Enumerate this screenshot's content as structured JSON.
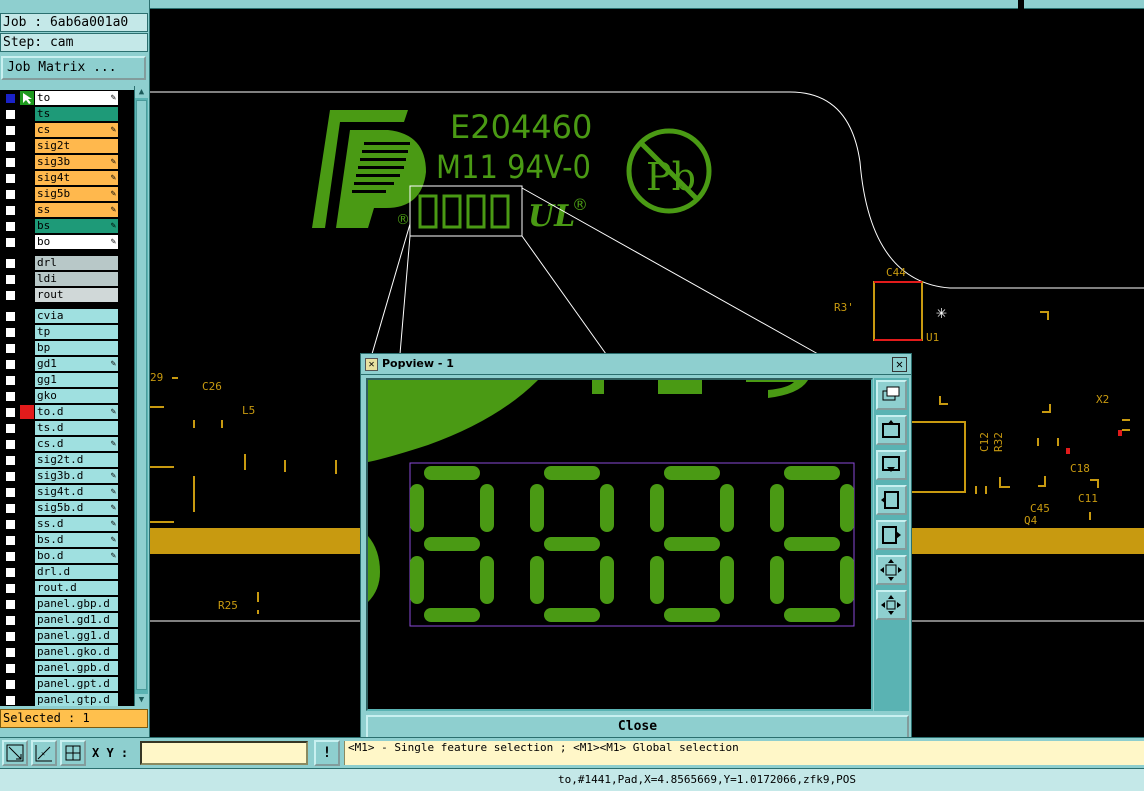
{
  "colors": {
    "panel_bg": "#8ecfcf",
    "canvas_bg": "#000000",
    "copper_green": "#4a9a14",
    "layer_orange": "#ffb84d",
    "layer_teal": "#1e9a78",
    "layer_light_cyan": "#9fe0e0",
    "layer_gray": "#b8c8c8",
    "marker_red": "#e21b1b",
    "trace_gold": "#c89a10",
    "silk_white": "#ffffff",
    "highlight_purple": "#8a4ad8"
  },
  "left_panel": {
    "job_label": "Job : 6ab6a001a0",
    "step_label": "Step: cam",
    "job_matrix_button": "Job Matrix ...",
    "selected_label": "Selected : 1",
    "layers": [
      {
        "name": "to",
        "color": "#ffffff",
        "checked": true,
        "marker": "cursor",
        "editable": true,
        "group": 1
      },
      {
        "name": "ts",
        "color": "#1e9a78",
        "checked": false,
        "editable": false,
        "group": 1
      },
      {
        "name": "cs",
        "color": "#ffb84d",
        "checked": false,
        "editable": true,
        "group": 1
      },
      {
        "name": "sig2t",
        "color": "#ffb84d",
        "checked": false,
        "editable": false,
        "group": 1
      },
      {
        "name": "sig3b",
        "color": "#ffb84d",
        "checked": false,
        "editable": true,
        "group": 1
      },
      {
        "name": "sig4t",
        "color": "#ffb84d",
        "checked": false,
        "editable": true,
        "group": 1
      },
      {
        "name": "sig5b",
        "color": "#ffb84d",
        "checked": false,
        "editable": true,
        "group": 1
      },
      {
        "name": "ss",
        "color": "#ffb84d",
        "checked": false,
        "editable": true,
        "group": 1
      },
      {
        "name": "bs",
        "color": "#1e9a78",
        "checked": false,
        "editable": true,
        "group": 1
      },
      {
        "name": "bo",
        "color": "#ffffff",
        "checked": false,
        "editable": true,
        "group": 1
      },
      {
        "name": "drl",
        "color": "#b8c8c8",
        "checked": false,
        "editable": false,
        "group": 2
      },
      {
        "name": "ldi",
        "color": "#b8c8c8",
        "checked": false,
        "editable": false,
        "group": 2
      },
      {
        "name": "rout",
        "color": "#d0d8d8",
        "checked": false,
        "editable": false,
        "group": 2
      },
      {
        "name": "cvia",
        "color": "#9fe0e0",
        "checked": false,
        "editable": false,
        "group": 3
      },
      {
        "name": "tp",
        "color": "#9fe0e0",
        "checked": false,
        "editable": false,
        "group": 3
      },
      {
        "name": "bp",
        "color": "#9fe0e0",
        "checked": false,
        "editable": false,
        "group": 3
      },
      {
        "name": "gd1",
        "color": "#9fe0e0",
        "checked": false,
        "editable": true,
        "group": 3
      },
      {
        "name": "gg1",
        "color": "#9fe0e0",
        "checked": false,
        "editable": false,
        "group": 3
      },
      {
        "name": "gko",
        "color": "#9fe0e0",
        "checked": false,
        "editable": false,
        "group": 3
      },
      {
        "name": "to.d",
        "color": "#9fe0e0",
        "checked": false,
        "marker": "red",
        "editable": true,
        "group": 3
      },
      {
        "name": "ts.d",
        "color": "#9fe0e0",
        "checked": false,
        "editable": false,
        "group": 3
      },
      {
        "name": "cs.d",
        "color": "#9fe0e0",
        "checked": false,
        "editable": true,
        "group": 3
      },
      {
        "name": "sig2t.d",
        "color": "#9fe0e0",
        "checked": false,
        "editable": false,
        "group": 3
      },
      {
        "name": "sig3b.d",
        "color": "#9fe0e0",
        "checked": false,
        "editable": true,
        "group": 3
      },
      {
        "name": "sig4t.d",
        "color": "#9fe0e0",
        "checked": false,
        "editable": true,
        "group": 3
      },
      {
        "name": "sig5b.d",
        "color": "#9fe0e0",
        "checked": false,
        "editable": true,
        "group": 3
      },
      {
        "name": "ss.d",
        "color": "#9fe0e0",
        "checked": false,
        "editable": true,
        "group": 3
      },
      {
        "name": "bs.d",
        "color": "#9fe0e0",
        "checked": false,
        "editable": true,
        "group": 3
      },
      {
        "name": "bo.d",
        "color": "#9fe0e0",
        "checked": false,
        "editable": true,
        "group": 3
      },
      {
        "name": "drl.d",
        "color": "#9fe0e0",
        "checked": false,
        "editable": false,
        "group": 3
      },
      {
        "name": "rout.d",
        "color": "#9fe0e0",
        "checked": false,
        "editable": false,
        "group": 3
      },
      {
        "name": "panel.gbp.d",
        "color": "#9fe0e0",
        "checked": false,
        "editable": false,
        "group": 3
      },
      {
        "name": "panel.gd1.d",
        "color": "#9fe0e0",
        "checked": false,
        "editable": false,
        "group": 3
      },
      {
        "name": "panel.gg1.d",
        "color": "#9fe0e0",
        "checked": false,
        "editable": false,
        "group": 3
      },
      {
        "name": "panel.gko.d",
        "color": "#9fe0e0",
        "checked": false,
        "editable": false,
        "group": 3
      },
      {
        "name": "panel.gpb.d",
        "color": "#9fe0e0",
        "checked": false,
        "editable": false,
        "group": 3
      },
      {
        "name": "panel.gpt.d",
        "color": "#9fe0e0",
        "checked": false,
        "editable": false,
        "group": 3
      },
      {
        "name": "panel.gtp.d",
        "color": "#9fe0e0",
        "checked": false,
        "editable": false,
        "group": 3
      }
    ]
  },
  "canvas": {
    "ul_number": "E204460",
    "ul_rating": "M11 94V-0",
    "pb_symbol": "Pb",
    "registered_mark": "®",
    "refdes": {
      "c44": "C44",
      "r3": "R3'",
      "u1": "U1",
      "c26": "C26",
      "l5": "L5",
      "r29": "29",
      "x2": "X2",
      "c12": "C12",
      "r32": "R32",
      "c18": "C18",
      "c11": "C11",
      "c45": "C45",
      "q4": "Q4",
      "r25": "R25"
    }
  },
  "popview": {
    "title": "Popview - 1",
    "close_label": "Close",
    "close_x": "✕",
    "tool_icons": [
      "window-stack-icon",
      "zoom-home-icon",
      "pan-down-icon",
      "pan-left-icon",
      "pan-right-icon",
      "zoom-in-icon",
      "zoom-fit-icon"
    ]
  },
  "bottom_bar": {
    "xy_label": "X Y :",
    "xy_value": "",
    "warn_label": "!",
    "hint": "<M1> - Single feature selection ; <M1><M1> Global selection"
  },
  "status": {
    "text": "to,#1441,Pad,X=4.8565669,Y=1.0172066,zfk9,POS"
  }
}
